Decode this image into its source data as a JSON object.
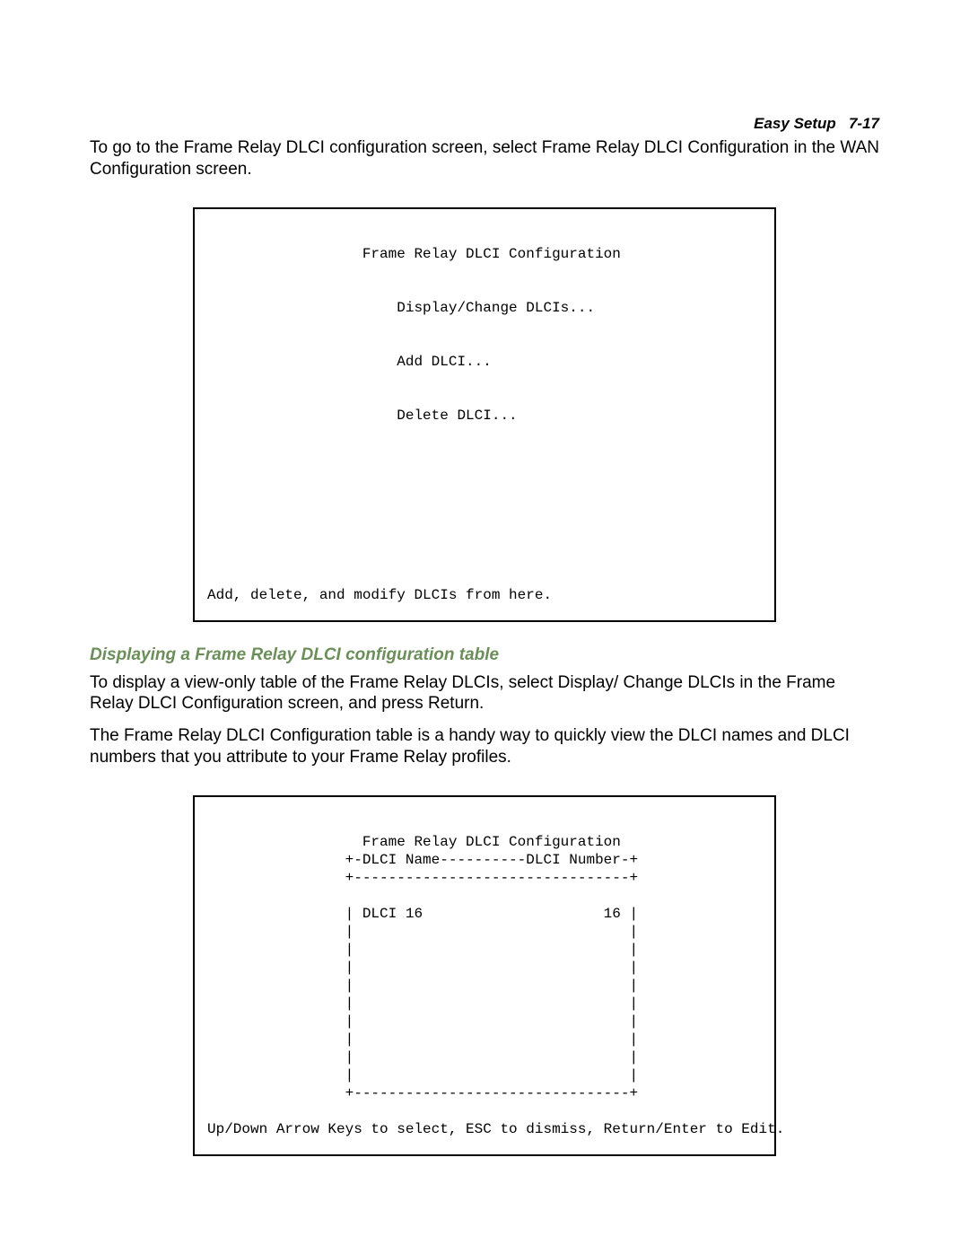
{
  "header": {
    "section": "Easy Setup",
    "page": "7-17"
  },
  "intro_paragraph": "To go to the Frame Relay DLCI configuration screen, select Frame Relay DLCI Configuration in the WAN Configuration screen.",
  "screen1": {
    "title_line": "                  Frame Relay DLCI Configuration",
    "menu1": "                      Display/Change DLCIs...",
    "menu2": "                      Add DLCI...",
    "menu3": "                      Delete DLCI...",
    "footer": "Add, delete, and modify DLCIs from here."
  },
  "subheading": "Displaying a Frame Relay DLCI configuration table",
  "para2": "To display a view-only table of the Frame Relay DLCIs, select Display/ Change DLCIs in the Frame Relay DLCI Configuration screen, and press Return.",
  "para3": "The Frame Relay DLCI Configuration table is a handy way to quickly view the DLCI names and DLCI numbers that you attribute to your Frame Relay profiles.",
  "screen2": {
    "line1": "                  Frame Relay DLCI Configuration",
    "line2": "                +-DLCI Name----------DLCI Number-+",
    "line3": "                +--------------------------------+",
    "line4": "                | DLCI 16                     16 |",
    "line5": "                |                                |",
    "line6": "                |                                |",
    "line7": "                |                                |",
    "line8": "                |                                |",
    "line9": "                |                                |",
    "line10": "                |                                |",
    "line11": "                |                                |",
    "line12": "                |                                |",
    "line13": "                |                                |",
    "line14": "                +--------------------------------+",
    "footer": "Up/Down Arrow Keys to select, ESC to dismiss, Return/Enter to Edit."
  }
}
